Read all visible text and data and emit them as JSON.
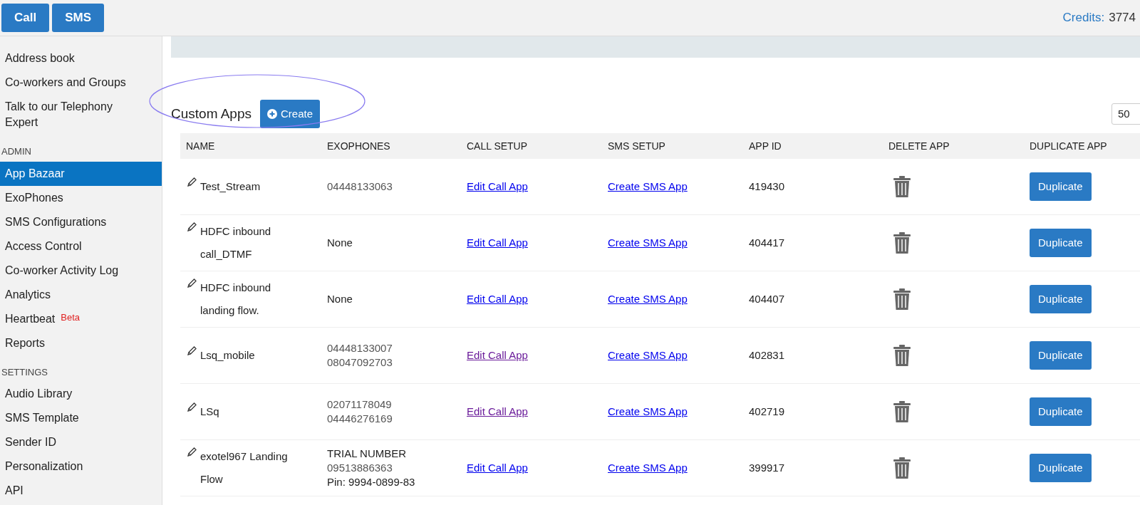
{
  "top_bar": {
    "buttons": [
      "Call",
      "SMS"
    ],
    "credits_label": "Credits:",
    "credits_value": "3774"
  },
  "sidebar": {
    "sections": [
      {
        "items": [
          {
            "label": "Address book",
            "selected": false
          },
          {
            "label": "Co-workers and Groups",
            "selected": false
          },
          {
            "label": "Talk to our Telephony Expert",
            "selected": false
          }
        ]
      },
      {
        "header": "ADMIN",
        "items": [
          {
            "label": "App Bazaar",
            "selected": true
          },
          {
            "label": "ExoPhones",
            "selected": false
          },
          {
            "label": "SMS Configurations",
            "selected": false
          },
          {
            "label": "Access Control",
            "selected": false
          },
          {
            "label": "Co-worker Activity Log",
            "selected": false
          },
          {
            "label": "Analytics",
            "selected": false
          },
          {
            "label": "Heartbeat",
            "badge": "Beta",
            "selected": false
          },
          {
            "label": "Reports",
            "selected": false
          }
        ]
      },
      {
        "header": "SETTINGS",
        "items": [
          {
            "label": "Audio Library",
            "selected": false
          },
          {
            "label": "SMS Template",
            "selected": false
          },
          {
            "label": "Sender ID",
            "selected": false
          },
          {
            "label": "Personalization",
            "selected": false
          },
          {
            "label": "API",
            "selected": false
          }
        ]
      }
    ]
  },
  "custom_apps": {
    "title": "Custom Apps",
    "create_button": "Create",
    "page_size": "50"
  },
  "table": {
    "columns": [
      "NAME",
      "EXOPHONES",
      "CALL SETUP",
      "SMS SETUP",
      "APP ID",
      "DELETE APP",
      "DUPLICATE APP"
    ],
    "rows": [
      {
        "name": "Test_Stream",
        "exophones": [
          "04448133063"
        ],
        "call_setup": {
          "label": "Edit Call App",
          "visited": false
        },
        "sms_setup": {
          "label": "Create SMS App",
          "visited": false
        },
        "app_id": "419430",
        "duplicate": "Duplicate"
      },
      {
        "name": "HDFC inbound call_DTMF",
        "exophones_text": "None",
        "call_setup": {
          "label": "Edit Call App",
          "visited": false
        },
        "sms_setup": {
          "label": "Create SMS App",
          "visited": false
        },
        "app_id": "404417",
        "duplicate": "Duplicate"
      },
      {
        "name": "HDFC inbound landing flow.",
        "exophones_text": "None",
        "call_setup": {
          "label": "Edit Call App",
          "visited": false
        },
        "sms_setup": {
          "label": "Create SMS App",
          "visited": false
        },
        "app_id": "404407",
        "duplicate": "Duplicate"
      },
      {
        "name": "Lsq_mobile",
        "exophones": [
          "04448133007",
          "08047092703"
        ],
        "call_setup": {
          "label": "Edit Call App",
          "visited": true
        },
        "sms_setup": {
          "label": "Create SMS App",
          "visited": false
        },
        "app_id": "402831",
        "duplicate": "Duplicate"
      },
      {
        "name": "LSq",
        "exophones": [
          "02071178049",
          "04446276169"
        ],
        "call_setup": {
          "label": "Edit Call App",
          "visited": true
        },
        "sms_setup": {
          "label": "Create SMS App",
          "visited": false
        },
        "app_id": "402719",
        "duplicate": "Duplicate"
      },
      {
        "name": "exotel967 Landing Flow",
        "trial": {
          "label": "TRIAL NUMBER",
          "number": "09513886363",
          "pin": "Pin: 9994-0899-83"
        },
        "call_setup": {
          "label": "Edit Call App",
          "visited": false
        },
        "sms_setup": {
          "label": "Create SMS App",
          "visited": false
        },
        "app_id": "399917",
        "duplicate": "Duplicate"
      }
    ]
  }
}
